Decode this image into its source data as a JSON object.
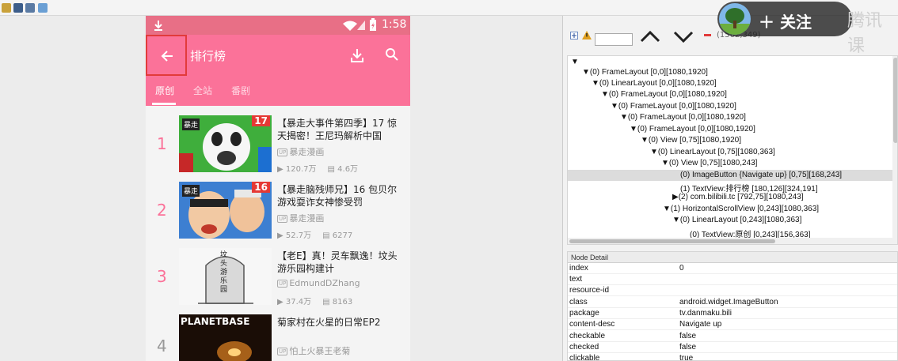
{
  "phone": {
    "status": {
      "time": "1:58"
    },
    "appbar": {
      "title": "排行榜"
    },
    "tabs": [
      "原创",
      "全站",
      "番剧"
    ],
    "rows": [
      {
        "rank": "1",
        "badge": "17",
        "title": "【暴走大事件第四季】17 惊天揭密！王尼玛解析中国",
        "uploader": "暴走漫画",
        "views": "120.7万",
        "danmaku": "4.6万"
      },
      {
        "rank": "2",
        "badge": "16",
        "title": "【暴走脑残师兄】16 包贝尔游戏耍诈女神惨受罚",
        "uploader": "暴走漫画",
        "views": "52.7万",
        "danmaku": "6277"
      },
      {
        "rank": "3",
        "badge": "",
        "title": "【老E】真！灵车飘逸！坟头游乐园构建计",
        "uploader": "EdmundDZhang",
        "views": "37.4万",
        "danmaku": "8163"
      },
      {
        "rank": "4",
        "badge": "",
        "title": "菊家村在火星的日常EP2",
        "uploader": "怕上火暴王老菊",
        "views": "",
        "danmaku": ""
      }
    ],
    "thumb_text": {
      "baozou": "暴走",
      "planet": "PLANETBASE",
      "grave": "坟头游乐园"
    },
    "up_tag": "UP"
  },
  "toolbar": {
    "coords": "(1562,349)"
  },
  "tree": {
    "root": "▼",
    "nodes": [
      "(0) FrameLayout [0,0][1080,1920]",
      "(0) LinearLayout [0,0][1080,1920]",
      "(0) FrameLayout [0,0][1080,1920]",
      "(0) FrameLayout [0,0][1080,1920]",
      "(0) FrameLayout [0,0][1080,1920]",
      "(0) FrameLayout [0,0][1080,1920]",
      "(0) View [0,75][1080,1920]",
      "(0) LinearLayout [0,75][1080,363]",
      "(0) View [0,75][1080,243]",
      "(0) ImageButton {Navigate up} [0,75][168,243]",
      "(1) TextView:排行榜 [180,126][324,191]",
      "(2) com.bilibili.tc [792,75][1080,243]",
      "(1) HorizontalScrollView [0,243][1080,363]",
      "(0) LinearLayout [0,243][1080,363]",
      "(0) TextView:原创 [0,243][156,363]"
    ]
  },
  "detail": {
    "header": "Node Detail",
    "rows": [
      [
        "index",
        "0"
      ],
      [
        "text",
        ""
      ],
      [
        "resource-id",
        ""
      ],
      [
        "class",
        "android.widget.ImageButton"
      ],
      [
        "package",
        "tv.danmaku.bili"
      ],
      [
        "content-desc",
        "Navigate up"
      ],
      [
        "checkable",
        "false"
      ],
      [
        "checked",
        "false"
      ],
      [
        "clickable",
        "true"
      ]
    ]
  },
  "follow": {
    "label": "＋ 关注",
    "watermark": "腾讯课"
  },
  "colors": {
    "accent": "#fb7299",
    "status": "#e86f86",
    "highlight": "#e23b3b"
  }
}
